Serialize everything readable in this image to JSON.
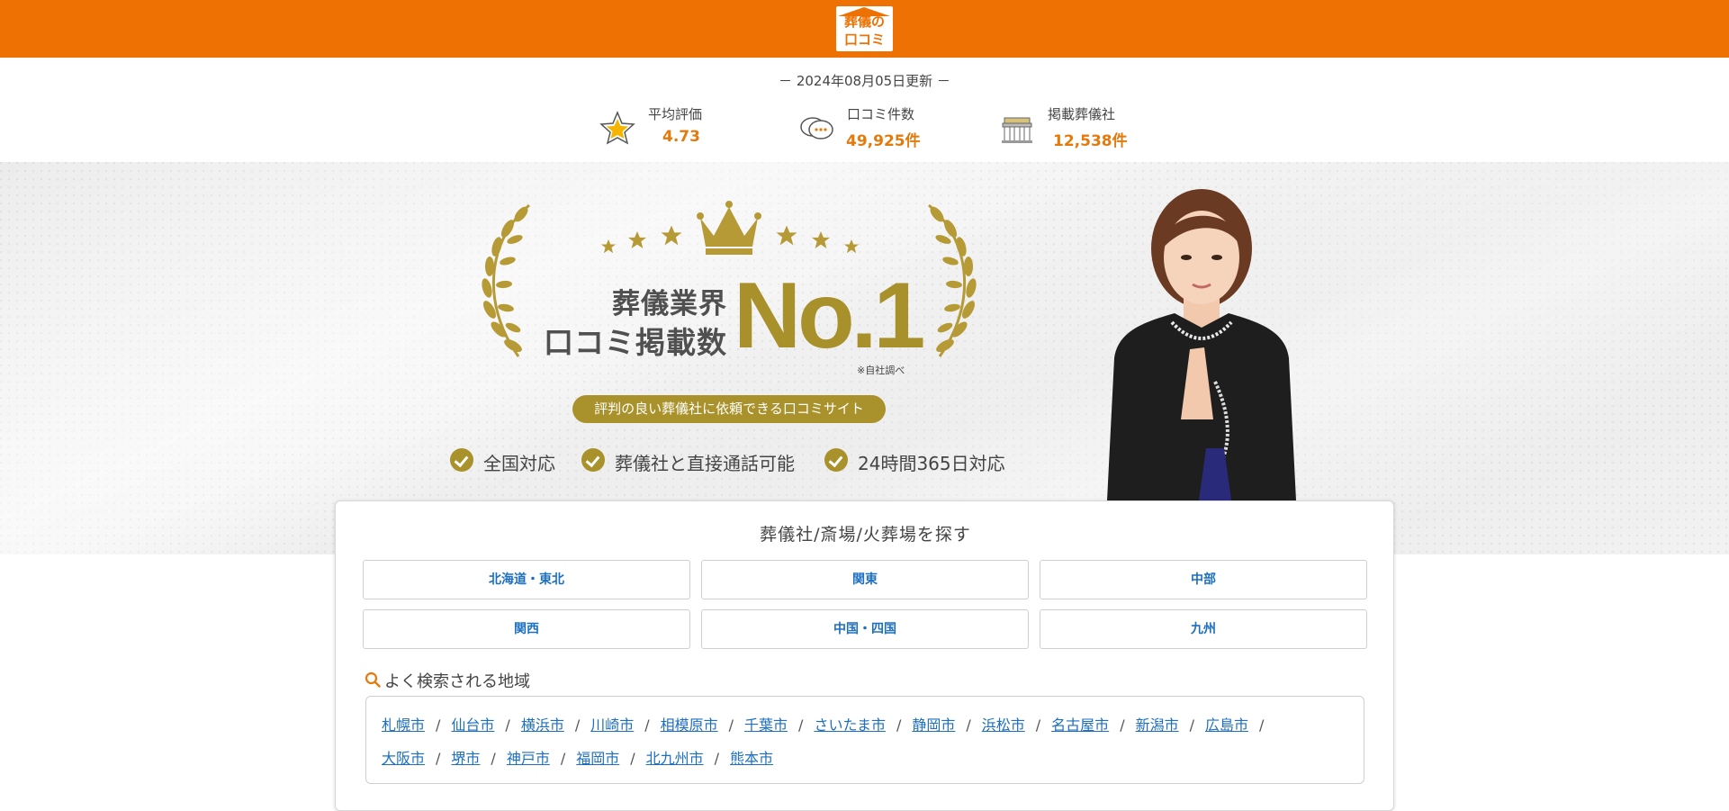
{
  "header": {
    "logo_line1": "葬儀の",
    "logo_line2": "口コミ",
    "brand_color": "#ee7203"
  },
  "stats": {
    "updated": "－ 2024年08月05日更新 －",
    "items": [
      {
        "icon": "star-icon",
        "label": "平均評価",
        "value": "4.73"
      },
      {
        "icon": "chat-bubbles-icon",
        "label": "口コミ件数",
        "value": "49,925件"
      },
      {
        "icon": "funeral-hall-icon",
        "label": "掲載葬儀社",
        "value": "12,538件"
      }
    ]
  },
  "hero": {
    "headline_line1": "葬儀業界",
    "headline_line2": "口コミ掲載数",
    "rank": "No.1",
    "note": "※自社調べ",
    "tagline": "評判の良い葬儀社に依頼できる口コミサイト",
    "features": [
      "全国対応",
      "葬儀社と直接通話可能",
      "24時間365日対応"
    ],
    "accent_color": "#a9922b"
  },
  "search": {
    "title": "葬儀社/斎場/火葬場を探す",
    "regions": [
      "北海道・東北",
      "関東",
      "中部",
      "関西",
      "中国・四国",
      "九州"
    ],
    "popular_label": "よく検索される地域",
    "cities_line1": [
      "札幌市",
      "仙台市",
      "横浜市",
      "川崎市",
      "相模原市",
      "千葉市",
      "さいたま市",
      "静岡市",
      "浜松市",
      "名古屋市",
      "新潟市",
      "広島市"
    ],
    "cities_line2": [
      "大阪市",
      "堺市",
      "神戸市",
      "福岡市",
      "北九州市",
      "熊本市"
    ],
    "link_color": "#1d6fc0"
  }
}
